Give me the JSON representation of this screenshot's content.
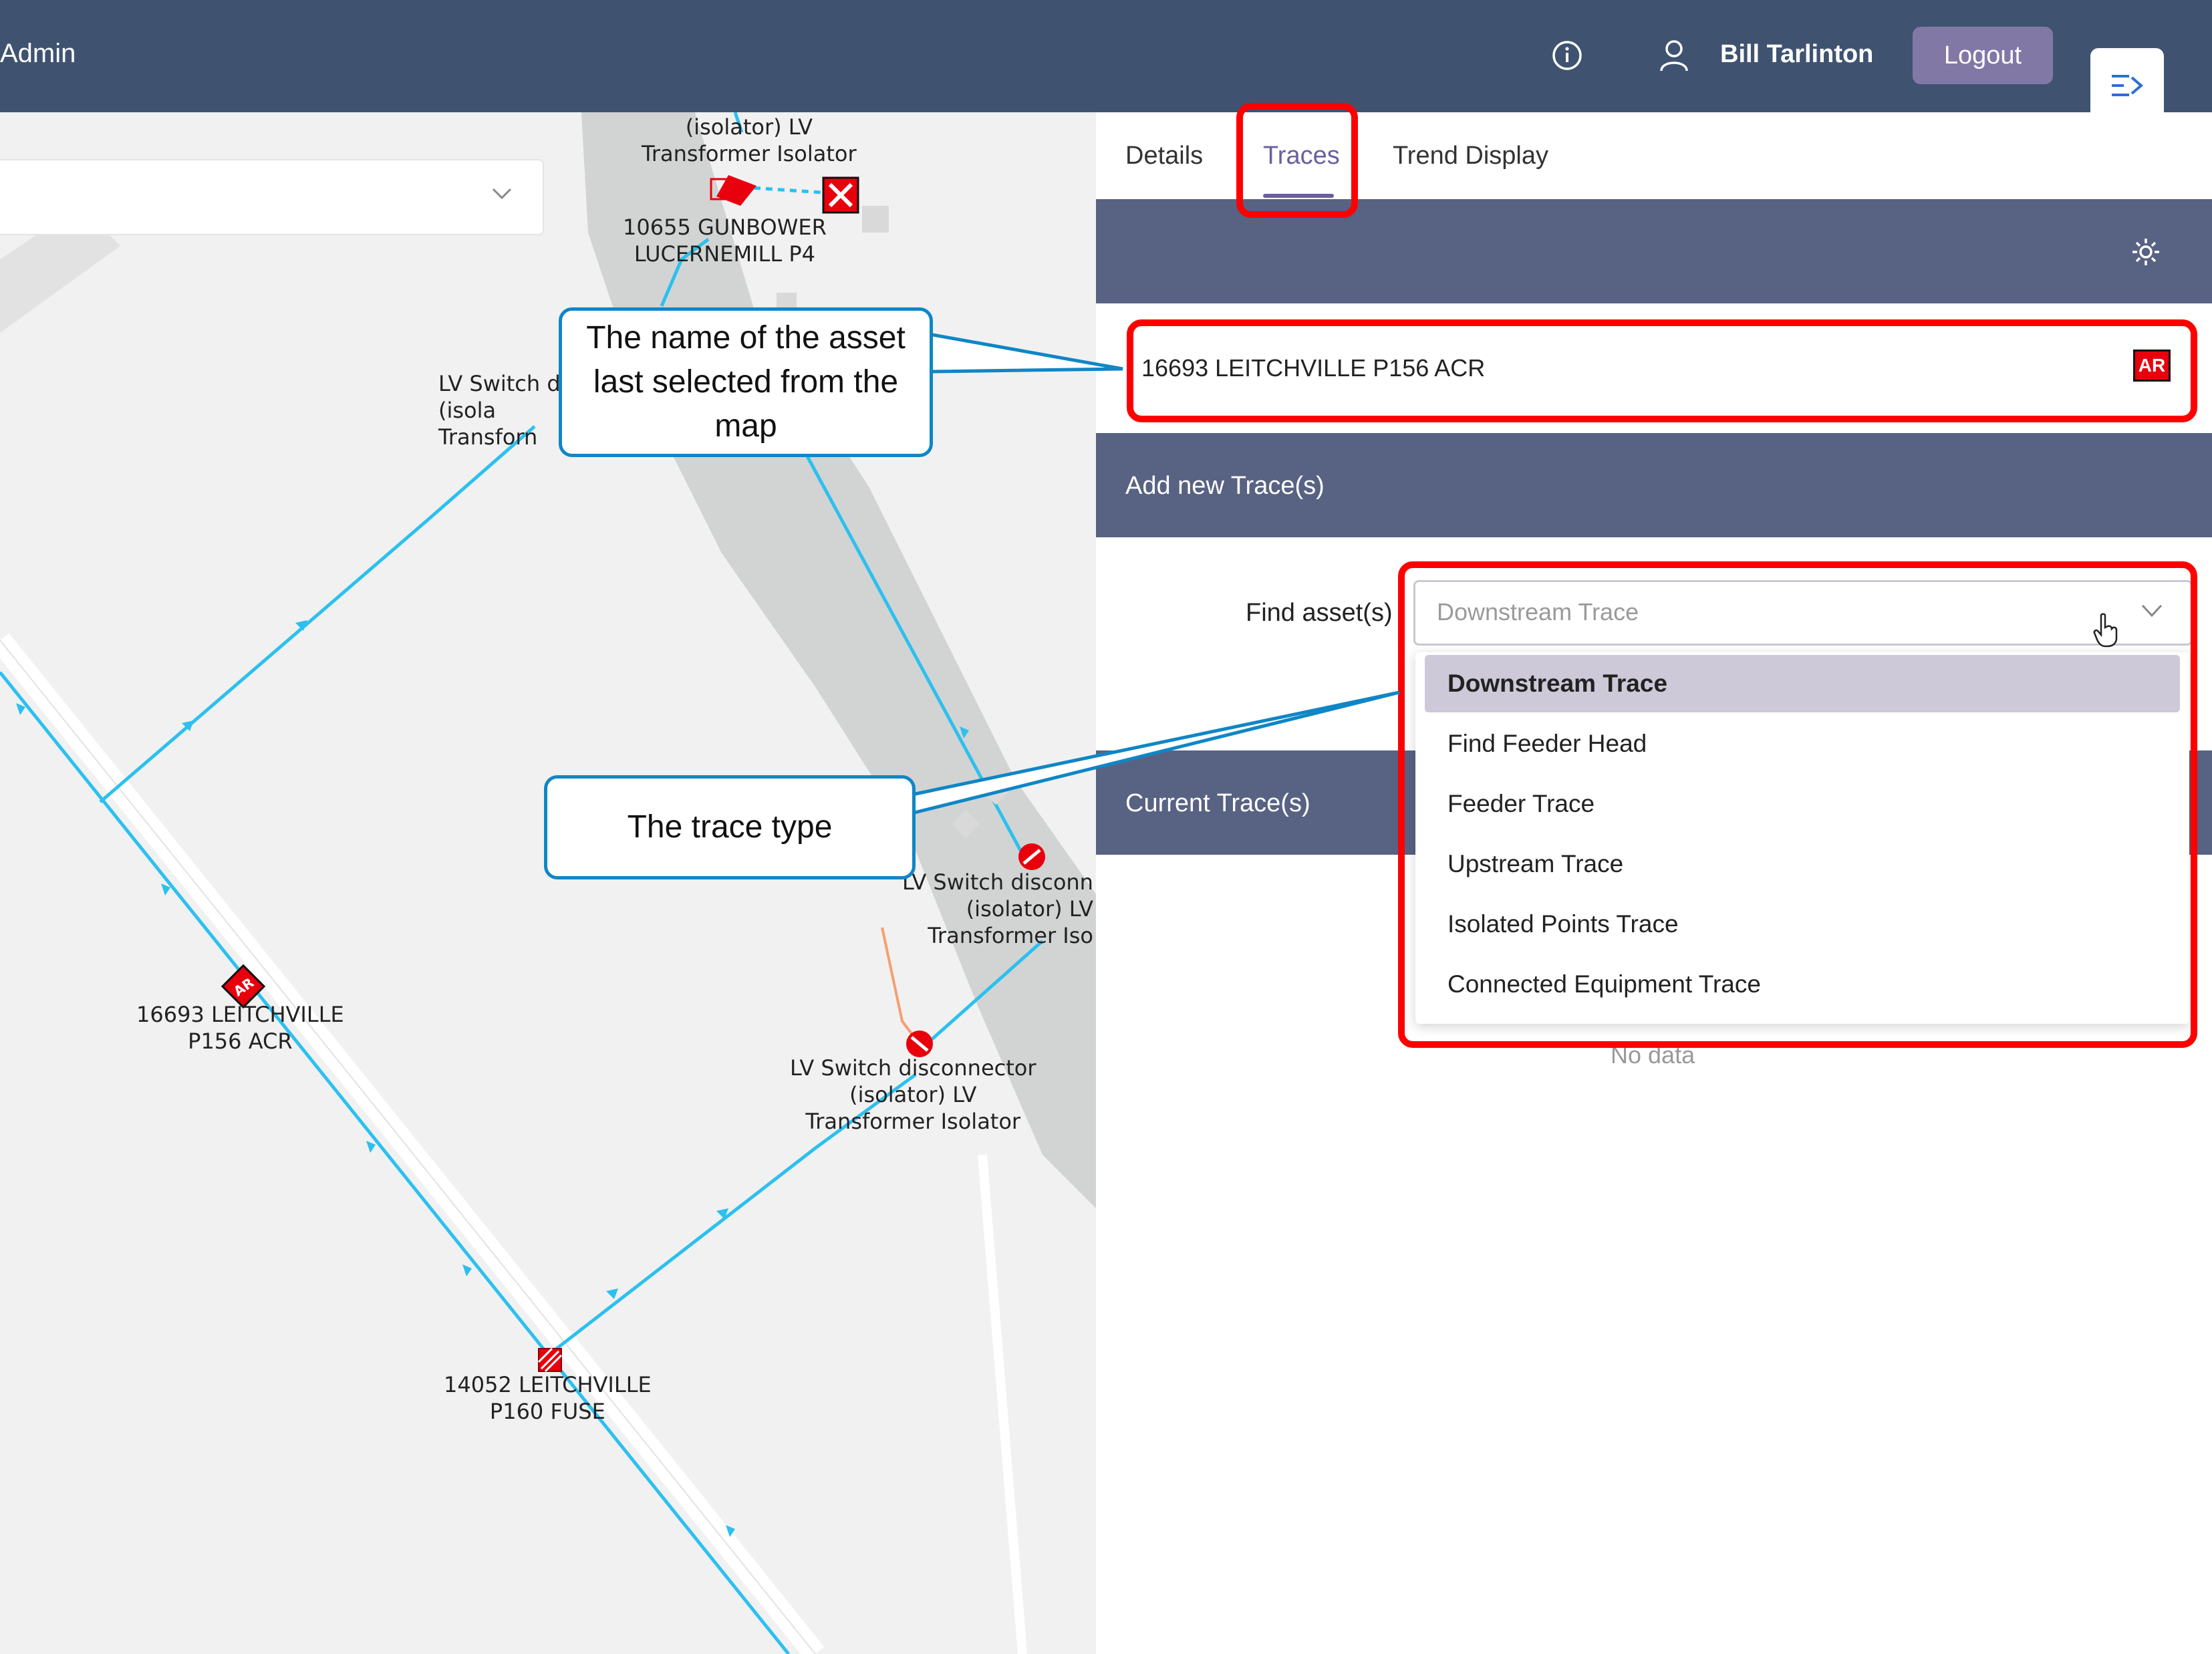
{
  "app": {
    "title_fragment": "Admin"
  },
  "header": {
    "user_name": "Bill Tarlinton",
    "logout_label": "Logout"
  },
  "tabs": [
    {
      "label": "Details"
    },
    {
      "label": "Traces",
      "active": true
    },
    {
      "label": "Trend Display"
    }
  ],
  "selected_asset": {
    "name": "16693 LEITCHVILLE P156 ACR",
    "badge": "AR"
  },
  "add_trace": {
    "title": "Add new Trace(s)",
    "find_label": "Find asset(s)",
    "placeholder": "Downstream Trace"
  },
  "trace_options": [
    "Downstream Trace",
    "Find Feeder Head",
    "Feeder Trace",
    "Upstream Trace",
    "Isolated Points Trace",
    "Connected Equipment Trace"
  ],
  "current_traces": {
    "title": "Current Trace(s)",
    "empty_text": "No data"
  },
  "callouts": {
    "asset_name": "The name of the asset last selected from the map",
    "trace_type": "The trace type"
  },
  "map_labels": {
    "top_isolator": "(isolator) LV\nTransformer Isolator",
    "gunbower": "10655 GUNBOWER\nLUCERNEMILL P4",
    "lv_switch_left": "LV Switch d\n(isola\nTransforn",
    "leitchville_acr": "16693 LEITCHVILLE\nP156 ACR",
    "lv_switch_right": "LV Switch disconn\n(isolator) LV\nTransformer Iso",
    "lv_switch_mid": "LV Switch disconnector\n(isolator) LV\nTransformer Isolator",
    "fuse": "14052 LEITCHVILLE\nP160 FUSE",
    "ar_marker": "AR"
  },
  "colors": {
    "header": "#3f5371",
    "band": "#586283",
    "accent": "#6b5e9e",
    "highlight": "#ff0000",
    "callout_border": "#0f86c6",
    "trace_line": "#2cc0ef"
  }
}
